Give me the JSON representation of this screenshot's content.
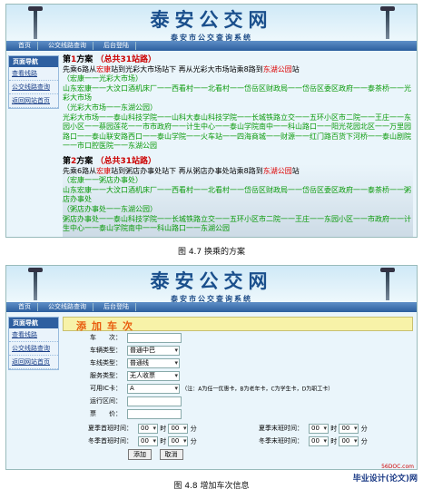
{
  "screenshot1": {
    "banner": {
      "logo": "泰安公交网",
      "subtitle": "泰安市公交查询系统"
    },
    "nav": [
      "首页",
      "公交线路查询",
      "后台登陆"
    ],
    "sidebar": {
      "title": "页面导航",
      "items": [
        "查看线路",
        "公交线路查询",
        "返回网站首页"
      ]
    },
    "solutions": [
      {
        "label_prefix": "第",
        "label_num": "1",
        "label_suffix": "方案",
        "count_text": "（总共31站路）",
        "line_a": "先乘6路从",
        "from": "宏康",
        "line_b": "站到光彩大市场站下 再从光彩大市场站乘8路到",
        "to": "东湖公园",
        "line_c": "站",
        "route1": "（宏康一一光彩大市场）",
        "route2": "山东宏康一一大汶口酒机床厂一一西看村一一北看村一一岱岳区财政局一一岱岳区委区政府一一泰茶桥一一光彩大市场",
        "route3": "（光彩大市场一一东湖公园）",
        "route4": "光彩大市场一一泰山科技学院一一山科大泰山科技学院一一长城铁路立交一一五环小区市二院一一王庄一一东园小区一一蔡园莲花一一市市政府一一计生中心一一泰山学院南中一一科山路口一一阳光花园北区一一万里园路口一一泰山联安路西口一一泰山学院一一火车站一一四海商城一一财源一一红门路百货下河桥一一泰山剧院一一市口腔医院一一东湖公园"
      },
      {
        "label_prefix": "第",
        "label_num": "2",
        "label_suffix": "方案",
        "count_text": "（总共31站路）",
        "line_a": "先乘6路从",
        "from": "宏康",
        "line_b": "站到粥店办事处站下 再从粥店办事处站乘8路到",
        "to": "东湖公园",
        "line_c": "站",
        "route1": "（宏康一一粥店办事处）",
        "route2": "山东宏康一一大汶口酒机床厂一一西看村一一北看村一一岱岳区财政局一一岱岳区委区政府一一泰茶桥一一粥店办事处",
        "route3": "（粥店办事处一一东湖公园）",
        "route4": "粥店办事处一一泰山科技学院一一长城铁路立交一一五环小区市二院一一王庄一一东园小区一一市政府一一计生中心一一泰山学院南中一一科山路口一一东湖公园"
      }
    ],
    "caption": "图 4.7  换乘的方案"
  },
  "screenshot2": {
    "banner": {
      "logo": "泰安公交网",
      "subtitle": "泰安市公交查询系统"
    },
    "nav": [
      "首页",
      "公交线路查询",
      "后台登陆"
    ],
    "sidebar": {
      "title": "页面导航",
      "items": [
        "查看线路",
        "公交线路查询",
        "返回网站首页"
      ]
    },
    "form_title": "添加车次",
    "fields": {
      "car_no": "车　　次：",
      "car_type": "车辆类型：",
      "car_type_value": "普通中巴",
      "line_type": "车线类型：",
      "line_type_value": "普通线",
      "service_type": "服务类型：",
      "service_type_value": "无人收票",
      "ic_card": "可用IC卡：",
      "ic_card_value": "A",
      "ic_note": "（注：A为任一优惠卡，B为老年卡，C为学生卡，D为职工卡）",
      "run_range": "运行区间：",
      "fare": "票　　价：",
      "summer_first": "夏季首班时间：",
      "summer_last": "夏季末班时间：",
      "winter_first": "冬季首班时间：",
      "winter_last": "冬季末班时间：",
      "hour_value": "00",
      "minute_value": "00",
      "hour_unit": "时",
      "minute_unit": "分"
    },
    "buttons": {
      "add": "添加",
      "cancel": "取消"
    },
    "caption": "图 4.8  增加车次信息"
  },
  "watermark": {
    "main": "毕业设计(论文)网",
    "small": "56DOC.com"
  }
}
